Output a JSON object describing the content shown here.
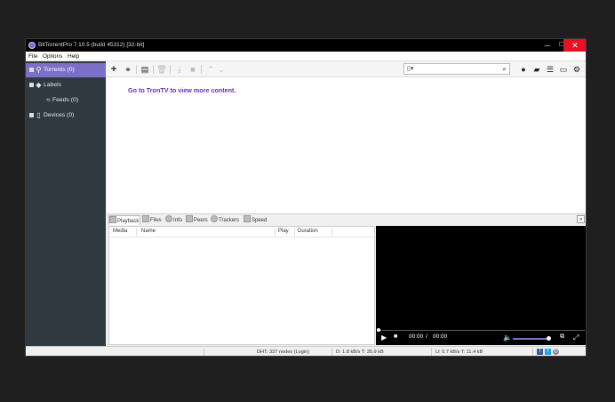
{
  "window": {
    "title": "BitTorrentPro 7.10.5  (build 45312) [32-bit]",
    "controls": {
      "minimize": "─",
      "maximize": "☐",
      "close": "✕"
    }
  },
  "menu": [
    "File",
    "Options",
    "Help"
  ],
  "sidebar": {
    "items": [
      {
        "label": "Torrents (0)",
        "icon": "torrents-icon",
        "active": true
      },
      {
        "label": "Labels",
        "icon": "tag-icon",
        "active": false
      },
      {
        "label": "Feeds (0)",
        "icon": "rss-icon",
        "active": false
      },
      {
        "label": "Devices (0)",
        "icon": "device-icon",
        "active": false
      }
    ]
  },
  "toolbar": {
    "buttons": [
      "add-torrent-icon",
      "add-url-icon",
      "create-torrent-icon",
      "remove-icon",
      "download-icon",
      "stop-icon",
      "move-up-icon",
      "move-down-icon"
    ],
    "right_buttons": [
      "bundle-icon",
      "chat-icon",
      "list-view-icon",
      "remote-icon",
      "settings-icon"
    ]
  },
  "main": {
    "promo_link": "Go to TronTV to view more content."
  },
  "tabs": [
    "Playback",
    "Files",
    "Info",
    "Peers",
    "Trackers",
    "Speed"
  ],
  "playlist": {
    "columns": [
      "Media",
      "Name",
      "Play",
      "Duration"
    ]
  },
  "player": {
    "time_current": "00:00",
    "time_separator": "/",
    "time_total": "00:00",
    "volume_fraction": 0.95
  },
  "status": {
    "dht": "DHT: 337 nodes (Login)",
    "download": "D: 1.8 kB/s T: 35.9 kB",
    "upload": "U: 0.7 kB/s T: 11.4 kB"
  },
  "colors": {
    "accent": "#7b6fc8",
    "sidebar_bg": "#2f3a40",
    "link": "#6a2fb5",
    "close_red": "#e81123"
  }
}
